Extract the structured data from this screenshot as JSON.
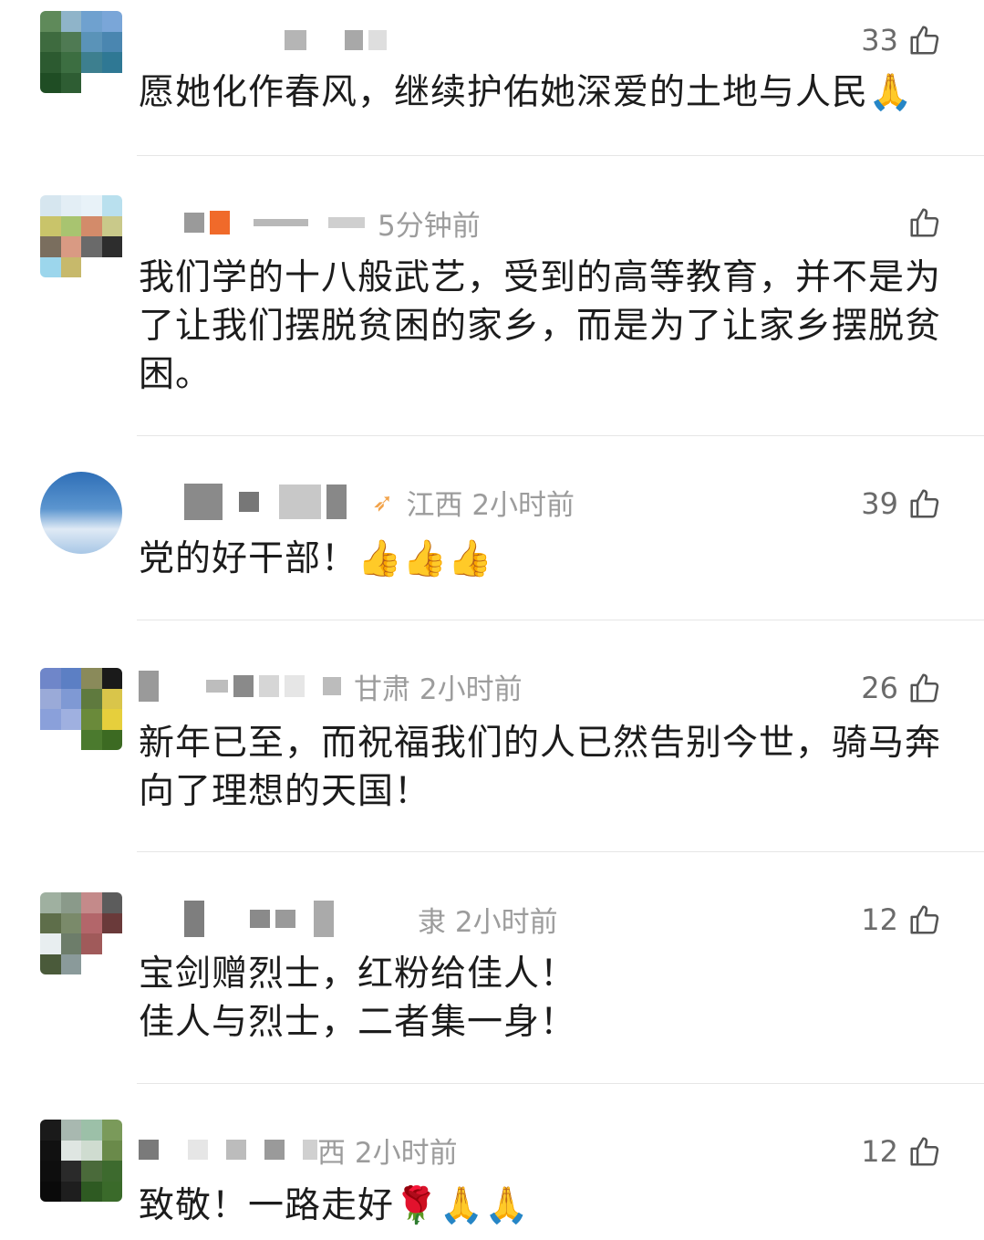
{
  "comments": [
    {
      "meta": "",
      "likes": "33",
      "text": "愿她化作春风，继续护佑她深爱的土地与人民🙏",
      "thumb_icon": "thumbs-up-outline-icon"
    },
    {
      "meta": "5分钟前",
      "likes": "",
      "text": "我们学的十八般武艺，受到的高等教育，并不是为了让我们摆脱贫困的家乡，而是为了让家乡摆脱贫困。",
      "thumb_icon": "thumbs-up-outline-icon"
    },
    {
      "meta": "江西 2小时前",
      "likes": "39",
      "text": "党的好干部！👍👍👍",
      "thumb_icon": "thumbs-up-outline-icon"
    },
    {
      "meta": "甘肃 2小时前",
      "likes": "26",
      "text": "新年已至，而祝福我们的人已然告别今世，骑马奔向了理想的天国！",
      "thumb_icon": "thumbs-up-outline-icon"
    },
    {
      "meta": "隶 2小时前",
      "likes": "12",
      "text_line1": "宝剑赠烈士，红粉给佳人！",
      "text_line2": "佳人与烈士，二者集一身！",
      "thumb_icon": "thumbs-up-outline-icon"
    },
    {
      "meta": "西 2小时前",
      "likes": "12",
      "text": "致敬！一路走好🌹🙏🙏",
      "thumb_icon": "thumbs-up-outline-icon"
    }
  ],
  "colors": {
    "meta_text": "#9c9c9c",
    "body_text": "#1c1c1c",
    "divider": "#e6e6e6"
  }
}
